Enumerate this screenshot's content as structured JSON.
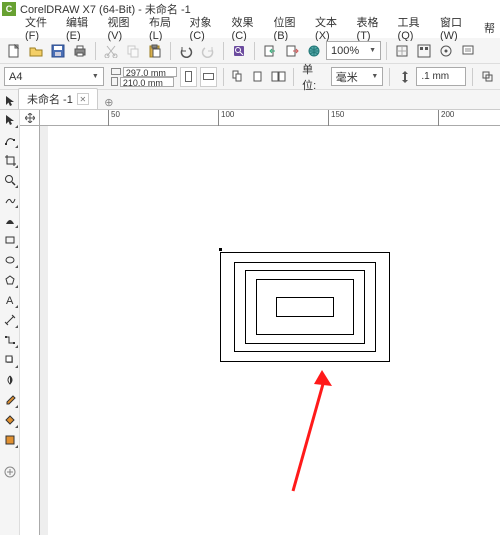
{
  "title": "CorelDRAW X7 (64-Bit) - 未命名 -1",
  "app_icon_letter": "C",
  "menus": [
    "文件(F)",
    "编辑(E)",
    "视图(V)",
    "布局(L)",
    "对象(C)",
    "效果(C)",
    "位图(B)",
    "文本(X)",
    "表格(T)",
    "工具(Q)",
    "窗口(W)",
    "帮"
  ],
  "zoom": "100%",
  "paper": {
    "size": "A4",
    "width": "297.0 mm",
    "height": "210.0 mm"
  },
  "units_label": "单位:",
  "units_value": "毫米",
  "nudge": ".1 mm",
  "tab_name": "未命名 -1",
  "ruler_ticks": [
    "50",
    "100",
    "150",
    "200"
  ],
  "chart_data": {
    "type": "diagram",
    "description": "Five concentric rectangles drawn on a blank CorelDRAW page with a red arrow annotation pointing to them",
    "rectangles_count": 5
  }
}
